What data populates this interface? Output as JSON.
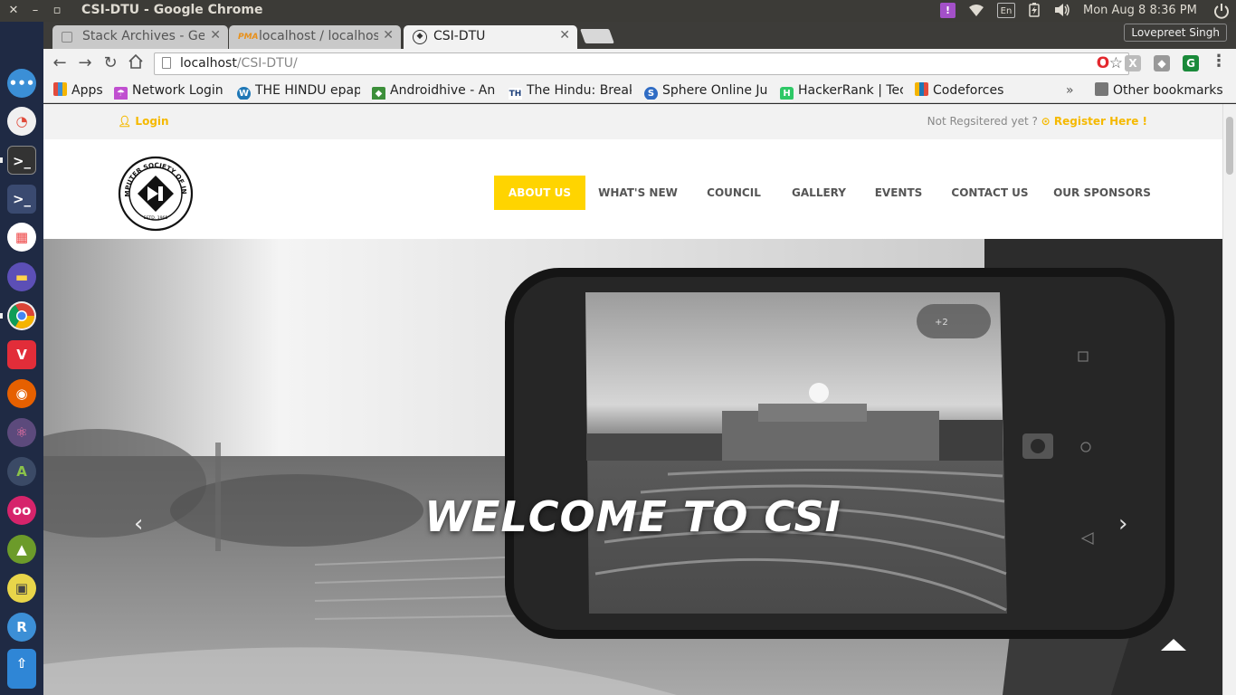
{
  "os_panel": {
    "window_title": "CSI-DTU - Google Chrome",
    "keyboard_layout": "En",
    "clock": "Mon Aug  8  8:36 PM"
  },
  "launcher": {
    "apps": [
      "apple-icon",
      "dash-icon",
      "pie-app-icon",
      "terminal-icon",
      "terminal-2-icon",
      "app-grid-icon",
      "files-icon",
      "chrome-icon",
      "vivaldi-icon",
      "firefox-icon",
      "atom-icon",
      "android-studio-icon",
      "flickr-icon",
      "appgrid-icon",
      "image-viewer-icon",
      "refresh-app-icon",
      "software-updater-icon"
    ]
  },
  "chrome": {
    "tabs": [
      {
        "label": "Stack Archives - Gee",
        "icon": "geeks-icon"
      },
      {
        "label": "localhost / localhos",
        "icon": "phpmyadmin-icon"
      },
      {
        "label": "CSI-DTU",
        "icon": "csi-favicon"
      }
    ],
    "profile_name": "Lovepreet Singh",
    "url_host": "localhost",
    "url_path": "/CSI-DTU/",
    "bookmarks": [
      {
        "label": "Apps",
        "color": "#e34b3c"
      },
      {
        "label": "Network Login",
        "color": "#c04fd0"
      },
      {
        "label": "THE HINDU epap",
        "color": "#1e77b6"
      },
      {
        "label": "Androidhive - An",
        "color": "#3c8f3a"
      },
      {
        "label": "The Hindu: Break",
        "color": "#1d3f7a"
      },
      {
        "label": "Sphere Online Ju",
        "color": "#2f6cc4"
      },
      {
        "label": "HackerRank | Tec",
        "color": "#2ec866"
      },
      {
        "label": "Codeforces",
        "color": "#e8a33a"
      }
    ],
    "bookmarks_overflow": "»",
    "other_bookmarks": "Other bookmarks"
  },
  "site": {
    "login_label": "Login",
    "register_prompt": "Not Regsitered yet ? ",
    "register_link": "Register Here !",
    "logo_text": "COMPUTER SOCIETY OF INDIA",
    "logo_estd": "ESTD. 1965",
    "nav": [
      "ABOUT US",
      "WHAT'S NEW",
      "COUNCIL",
      "GALLERY",
      "EVENTS",
      "CONTACT US",
      "OUR SPONSORS"
    ],
    "hero_title": "WELCOME TO CSI",
    "phone_badge": "+2"
  },
  "colors": {
    "accent": "#ffd400",
    "login_yellow": "#f5b900"
  }
}
